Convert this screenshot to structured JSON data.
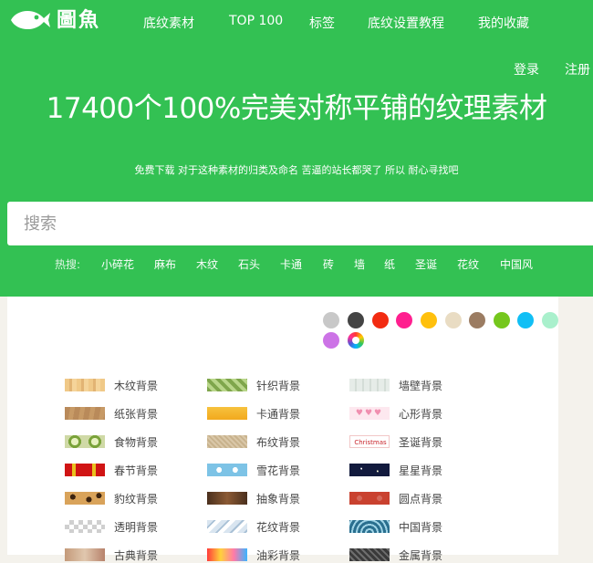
{
  "brand": {
    "logo_icon": "fish-icon",
    "name_chars": [
      "圖",
      "魚"
    ]
  },
  "nav": {
    "items": [
      {
        "label": "底纹素材"
      },
      {
        "label": "TOP 100"
      },
      {
        "label": "标签"
      },
      {
        "label": "底纹设置教程"
      },
      {
        "label": "我的收藏"
      }
    ]
  },
  "auth": {
    "login": "登录",
    "register": "注册"
  },
  "hero": {
    "headline": "17400个100%完美对称平铺的纹理素材",
    "subtitle": "免费下载 对于这种素材的归类及命名 苦逼的站长都哭了 所以 耐心寻找吧"
  },
  "search": {
    "placeholder": "搜索",
    "value": ""
  },
  "hot": {
    "label": "热搜:",
    "tags": [
      "小碎花",
      "麻布",
      "木纹",
      "石头",
      "卡通",
      "砖",
      "墙",
      "纸",
      "圣诞",
      "花纹",
      "中国风"
    ]
  },
  "colors": {
    "accent": "#33c153",
    "swatches": [
      "#c8c8c8",
      "#444444",
      "#f22b11",
      "#ff1f8f",
      "#ffc00d",
      "#e9dcc3",
      "#9b7c62",
      "#75c71d",
      "#11bff5",
      "#a9f0cc",
      "#cc73e6",
      "rainbow"
    ]
  },
  "categories": {
    "col1": [
      {
        "label": "木纹背景",
        "thumb": "wood"
      },
      {
        "label": "纸张背景",
        "thumb": "paper"
      },
      {
        "label": "食物背景",
        "thumb": "food"
      },
      {
        "label": "春节背景",
        "thumb": "spring"
      },
      {
        "label": "豹纹背景",
        "thumb": "leopard"
      },
      {
        "label": "透明背景",
        "thumb": "trans"
      },
      {
        "label": "古典背景",
        "thumb": "vintage"
      }
    ],
    "col2": [
      {
        "label": "针织背景",
        "thumb": "knit"
      },
      {
        "label": "卡通背景",
        "thumb": "cartoon"
      },
      {
        "label": "布纹背景",
        "thumb": "cloth"
      },
      {
        "label": "雪花背景",
        "thumb": "snow"
      },
      {
        "label": "抽象背景",
        "thumb": "abstract"
      },
      {
        "label": "花纹背景",
        "thumb": "flower"
      },
      {
        "label": "油彩背景",
        "thumb": "colorful"
      }
    ],
    "col3": [
      {
        "label": "墙壁背景",
        "thumb": "wall"
      },
      {
        "label": "心形背景",
        "thumb": "heart",
        "thumb_text": "♥♥♥"
      },
      {
        "label": "圣诞背景",
        "thumb": "xmas",
        "thumb_text": "Christmas"
      },
      {
        "label": "星星背景",
        "thumb": "star"
      },
      {
        "label": "圆点背景",
        "thumb": "dots"
      },
      {
        "label": "中国背景",
        "thumb": "china"
      },
      {
        "label": "金属背景",
        "thumb": "metal"
      }
    ]
  }
}
